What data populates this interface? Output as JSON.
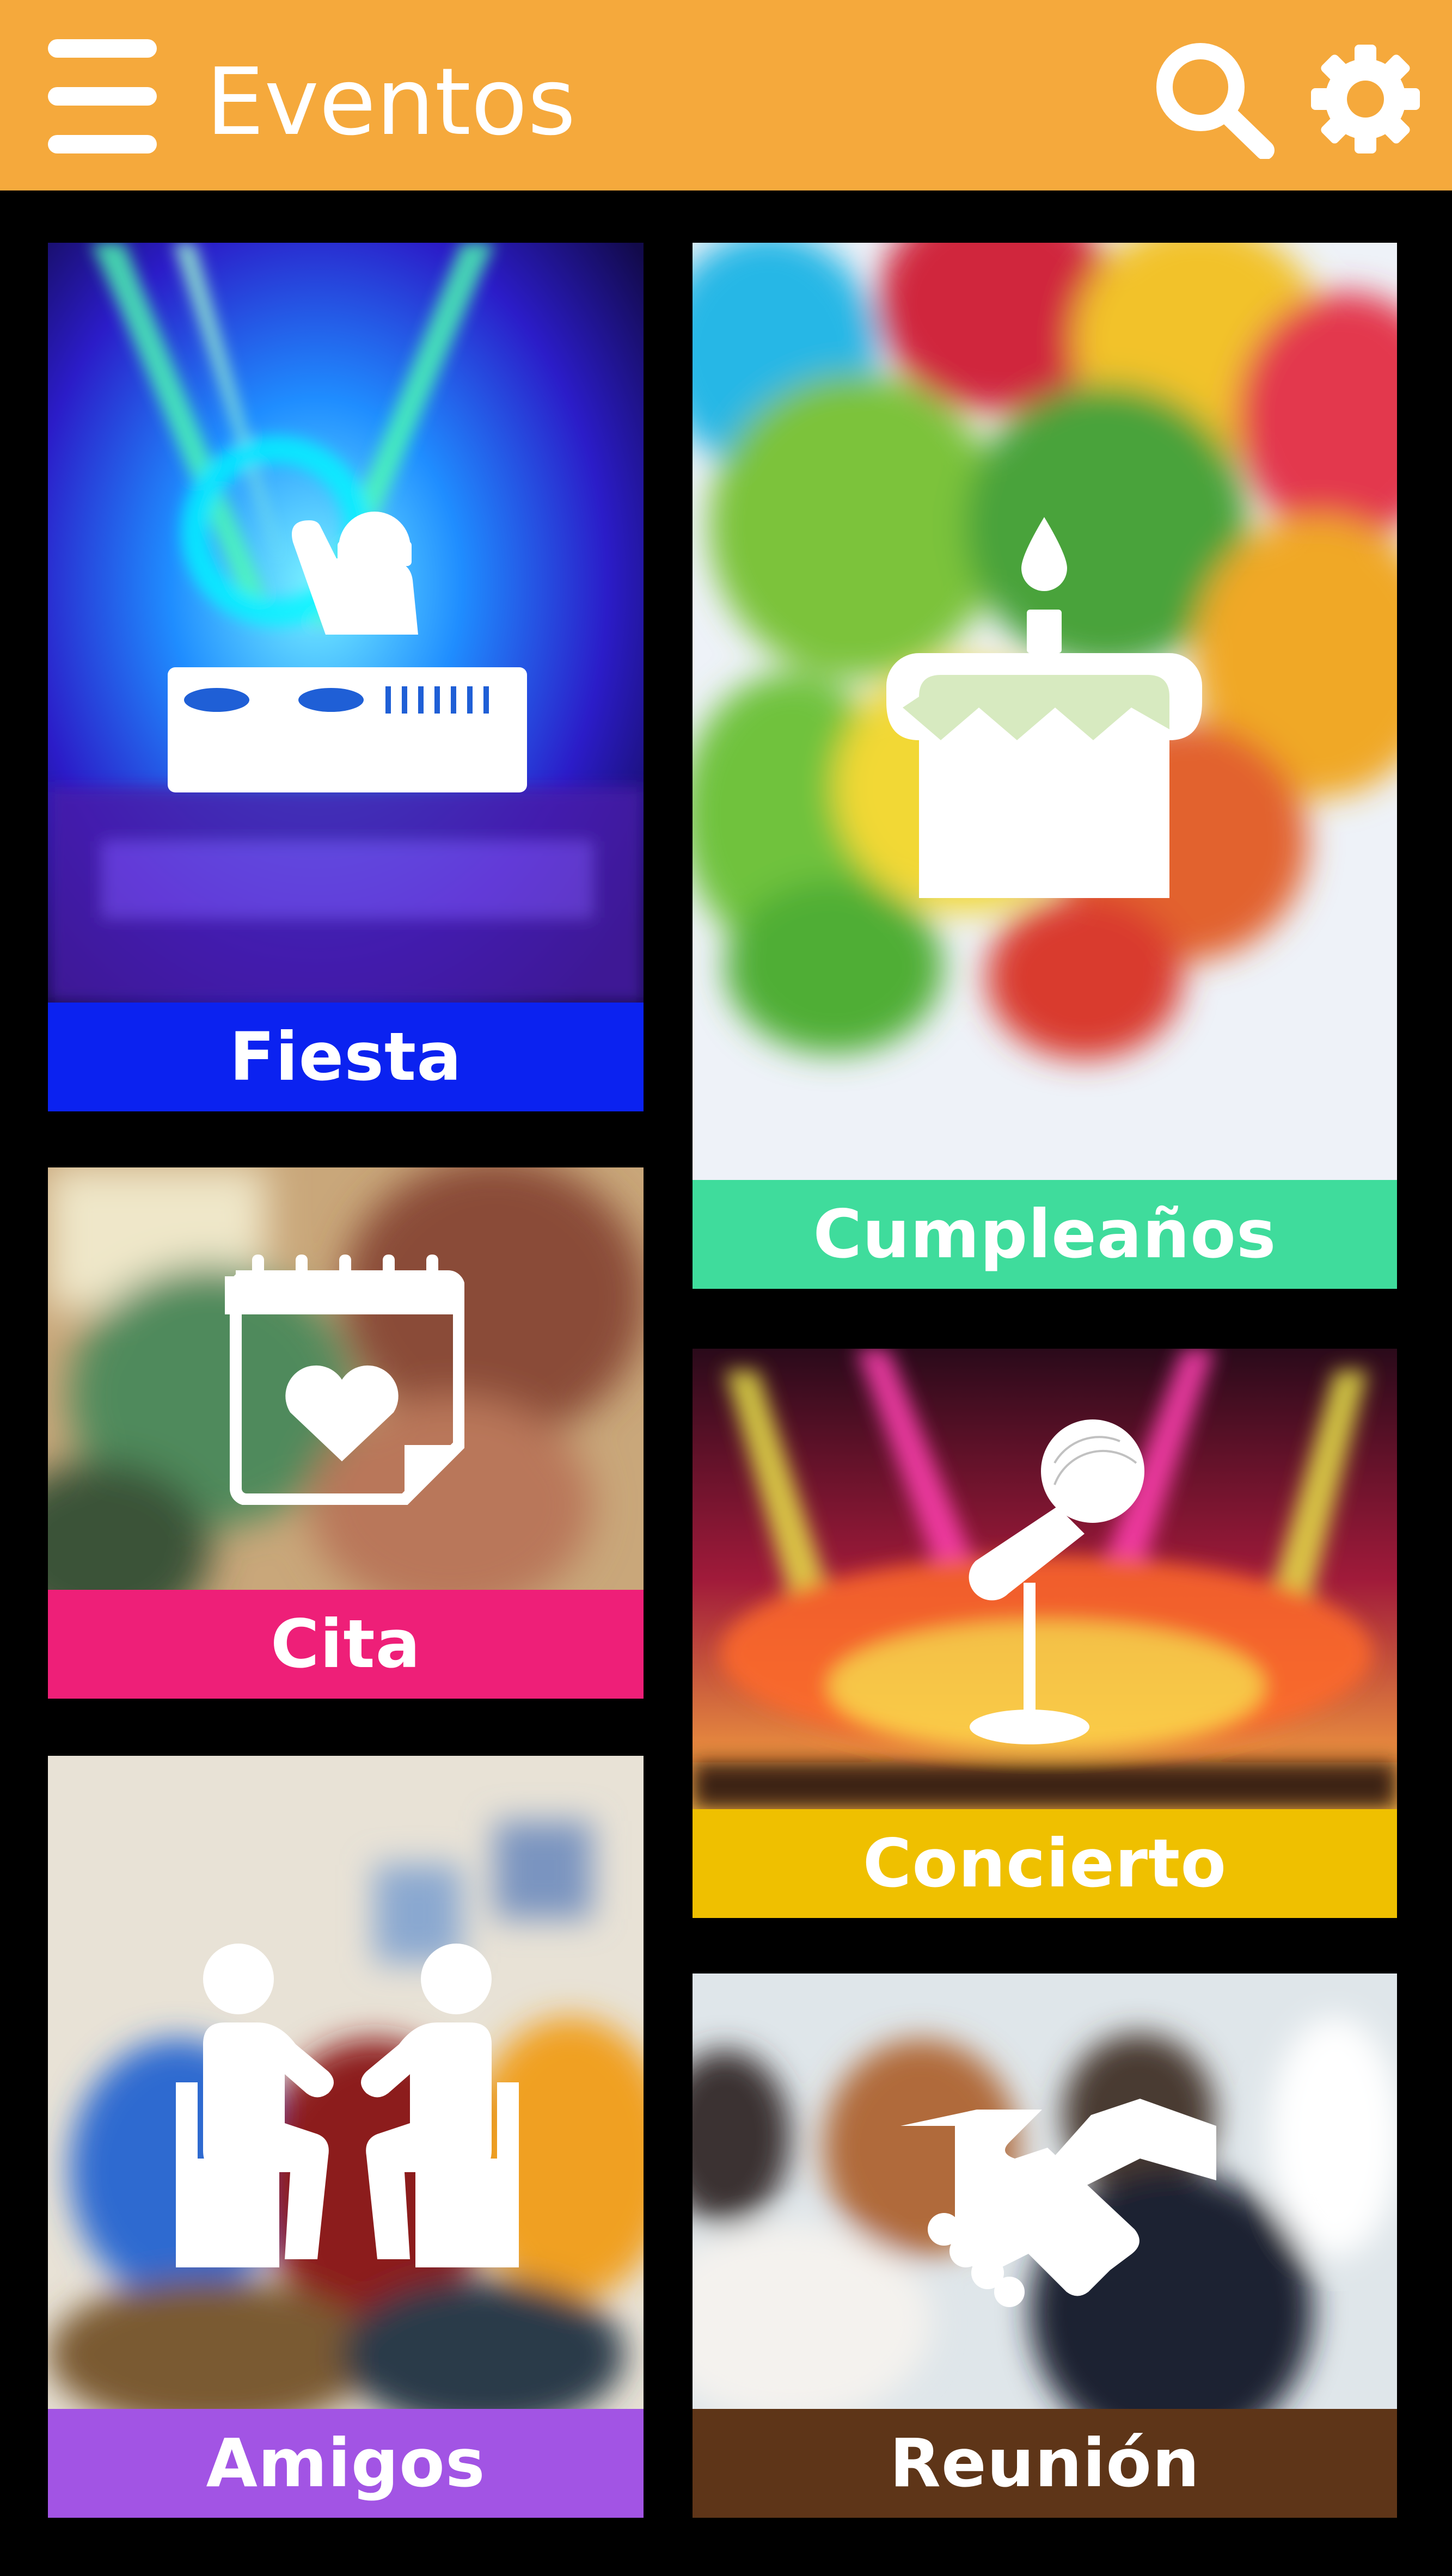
{
  "app": {
    "title": "Eventos"
  },
  "header": {
    "menu_icon": "hamburger-menu-icon",
    "search_icon": "search-icon",
    "settings_icon": "gear-icon"
  },
  "colors": {
    "app_bar": "#F5A93C",
    "background": "#000000",
    "fiesta": "#0B22F0",
    "cumpleanos": "#3FDC9C",
    "cita": "#EE1F78",
    "concierto": "#EFC000",
    "amigos": "#A254E4",
    "reunion": "#5E3518"
  },
  "events": [
    {
      "id": "fiesta",
      "label": "Fiesta",
      "icon": "dj-icon"
    },
    {
      "id": "cumpleanos",
      "label": "Cumpleaños",
      "icon": "birthday-cake-icon"
    },
    {
      "id": "cita",
      "label": "Cita",
      "icon": "calendar-heart-icon"
    },
    {
      "id": "concierto",
      "label": "Concierto",
      "icon": "microphone-icon"
    },
    {
      "id": "amigos",
      "label": "Amigos",
      "icon": "friends-icon"
    },
    {
      "id": "reunion",
      "label": "Reunión",
      "icon": "handshake-icon"
    }
  ]
}
